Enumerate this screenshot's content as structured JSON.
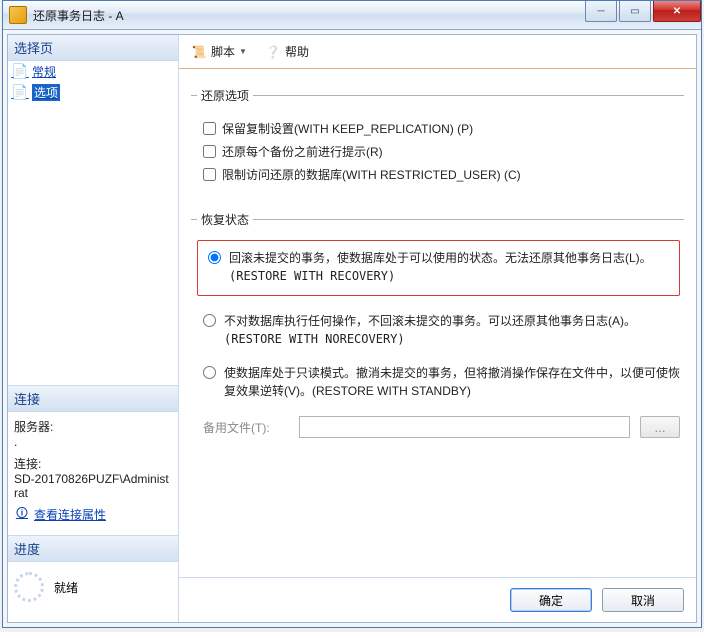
{
  "titlebar": {
    "title": "还原事务日志 - A"
  },
  "win_controls": {
    "min_glyph": "─",
    "max_glyph": "▭",
    "close_glyph": "✕"
  },
  "left": {
    "select_header": "选择页",
    "pages": [
      {
        "label": "常规",
        "icon_glyph": "📄",
        "selected": false
      },
      {
        "label": "选项",
        "icon_glyph": "📄",
        "selected": true
      }
    ],
    "connection_header": "连接",
    "server_label": "服务器:",
    "server_value": ".",
    "conn_label": "连接:",
    "conn_value": "SD-20170826PUZF\\Administrat",
    "view_conn_props": "查看连接属性",
    "view_conn_icon": "🛈",
    "progress_header": "进度",
    "progress_status": "就绪"
  },
  "toolbar": {
    "script_label": "脚本",
    "script_icon": "📜",
    "dropdown_glyph": "▼",
    "help_label": "帮助",
    "help_icon": "❔"
  },
  "restore_options": {
    "legend": "还原选项",
    "keep_replication": "保留复制设置(WITH KEEP_REPLICATION) (P)",
    "prompt_each_backup": "还原每个备份之前进行提示(R)",
    "restricted_user": "限制访问还原的数据库(WITH RESTRICTED_USER) (C)"
  },
  "recovery_state": {
    "legend": "恢复状态",
    "opt_recovery_line1": "回滚未提交的事务，使数据库处于可以使用的状态。无法还原其他事务日志(L)。",
    "opt_recovery_line2": "(RESTORE WITH RECOVERY)",
    "opt_norecovery_line1": "不对数据库执行任何操作，不回滚未提交的事务。可以还原其他事务日志(A)。",
    "opt_norecovery_line2": "(RESTORE WITH NORECOVERY)",
    "opt_standby_line1": "使数据库处于只读模式。撤消未提交的事务，但将撤消操作保存在文件中，以便可使恢复效果逆转(V)。(RESTORE WITH STANDBY)",
    "standby_file_label": "备用文件(T):",
    "standby_file_value": "",
    "ellipsis": "..."
  },
  "footer": {
    "ok": "确定",
    "cancel": "取消"
  }
}
